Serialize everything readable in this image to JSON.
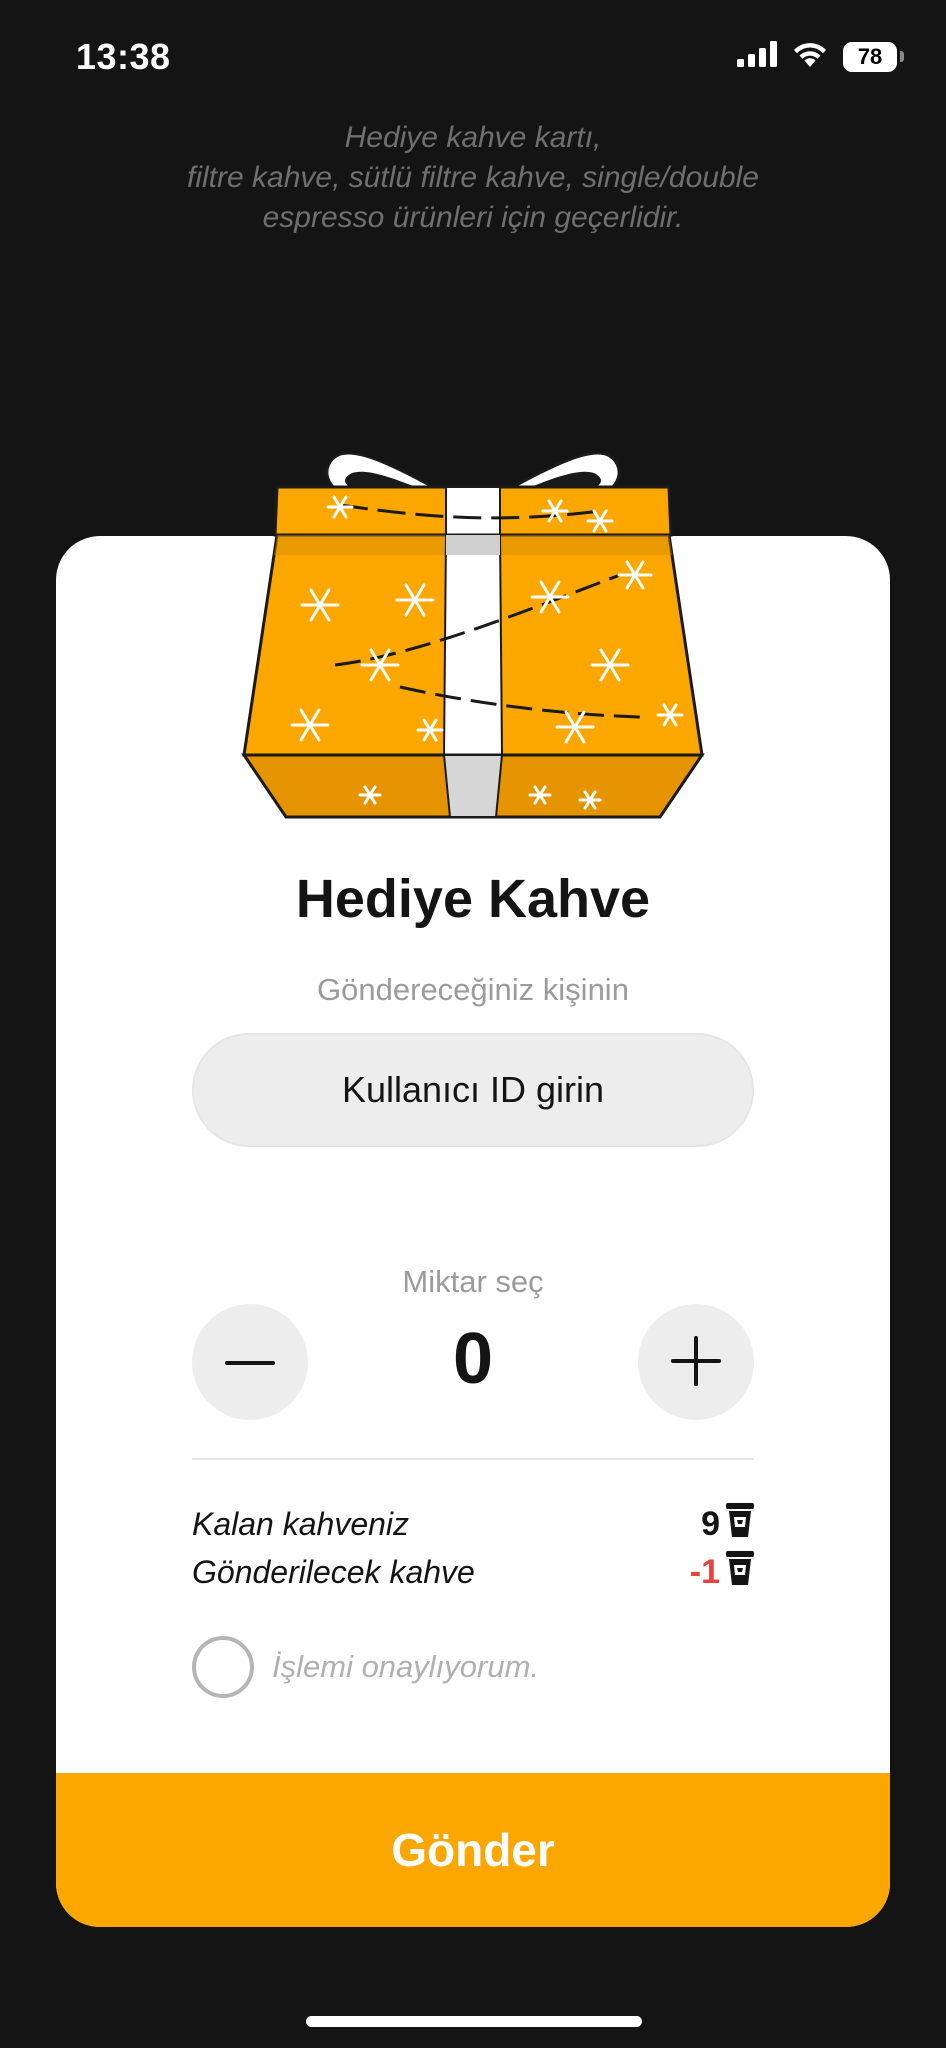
{
  "status_bar": {
    "time": "13:38",
    "battery": "78",
    "icons": [
      "signal-icon",
      "wifi-icon",
      "battery-icon"
    ]
  },
  "info": {
    "line1": "Hediye kahve kartı,",
    "line2": "filtre kahve, sütlü filtre kahve, single/double",
    "line3": "espresso ürünleri için geçerlidir."
  },
  "card": {
    "title": "Hediye Kahve",
    "recipient_label": "Göndereceğiniz kişinin",
    "recipient_placeholder": "Kullanıcı ID girin",
    "recipient_value": "",
    "amount_label": "Miktar seç",
    "amount_value": "0",
    "remaining_label": "Kalan kahveniz",
    "remaining_value": "9",
    "send_label": "Gönderilecek kahve",
    "send_value": "-1",
    "confirm_label": "İşlemi onaylıyorum.",
    "confirm_checked": false,
    "submit_label": "Gönder"
  },
  "colors": {
    "background": "#141414",
    "card": "#ffffff",
    "accent": "#fca600",
    "negative": "#e8433f",
    "input_bg": "#ededed"
  }
}
